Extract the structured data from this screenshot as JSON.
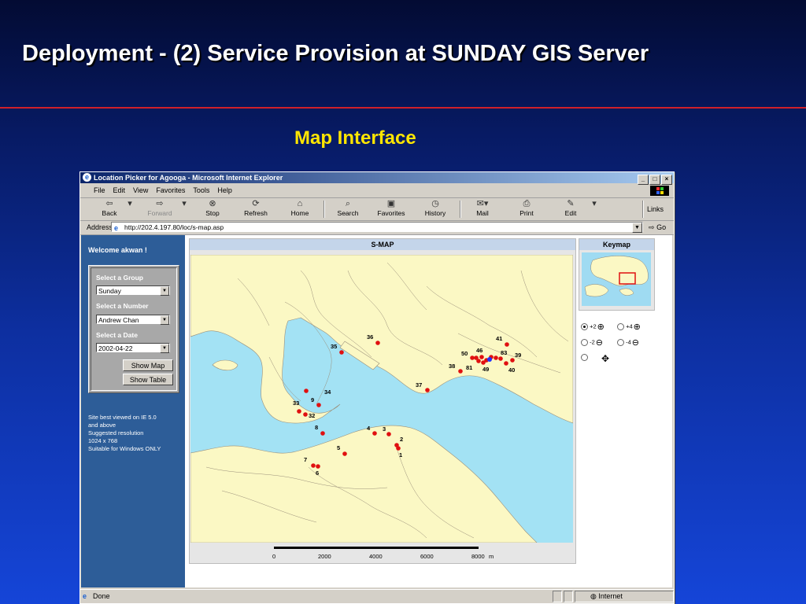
{
  "slide": {
    "title": "Deployment - (2) Service Provision at SUNDAY GIS Server",
    "subtitle": "Map Interface"
  },
  "browser": {
    "window_title": "Location Picker for Agooga - Microsoft Internet Explorer",
    "menu": [
      "File",
      "Edit",
      "View",
      "Favorites",
      "Tools",
      "Help"
    ],
    "toolbar": {
      "back": "Back",
      "forward": "Forward",
      "stop": "Stop",
      "refresh": "Refresh",
      "home": "Home",
      "search": "Search",
      "favorites": "Favorites",
      "history": "History",
      "mail": "Mail",
      "print": "Print",
      "edit": "Edit",
      "links": "Links"
    },
    "address_label": "Address",
    "address_url": "http://202.4.197.80/loc/s-map.asp",
    "go_label": "Go",
    "status_text": "Done",
    "status_zone": "Internet"
  },
  "sidebar": {
    "welcome": "Welcome akwan !",
    "group_label": "Select a Group",
    "group_value": "Sunday",
    "number_label": "Select a Number",
    "number_value": "Andrew Chan",
    "date_label": "Select a Date",
    "date_value": "2002-04-22",
    "show_map": "Show Map",
    "show_table": "Show Table",
    "notes": [
      "Site best viewed on IE 5.0",
      "and above",
      "Suggested resolution",
      "1024 x 768",
      "Suitable for Windows ONLY"
    ]
  },
  "smap": {
    "title": "S-MAP",
    "scale_labels": [
      "0",
      "2000",
      "4000",
      "6000",
      "8000",
      "m"
    ],
    "markers": [
      "1",
      "2",
      "3",
      "4",
      "5",
      "6",
      "7",
      "8",
      "9",
      "32",
      "33",
      "34",
      "35",
      "36",
      "37",
      "38",
      "39",
      "40",
      "41",
      "46",
      "49",
      "50",
      "81",
      "83"
    ],
    "marker_color": "#e01010",
    "land_color": "#fbf8c4",
    "water_color": "#a3e2f4"
  },
  "keymap": {
    "title": "Keymap"
  },
  "zoom": {
    "options": [
      "+2",
      "+4",
      "-2",
      "-4"
    ],
    "selected": "+2"
  }
}
